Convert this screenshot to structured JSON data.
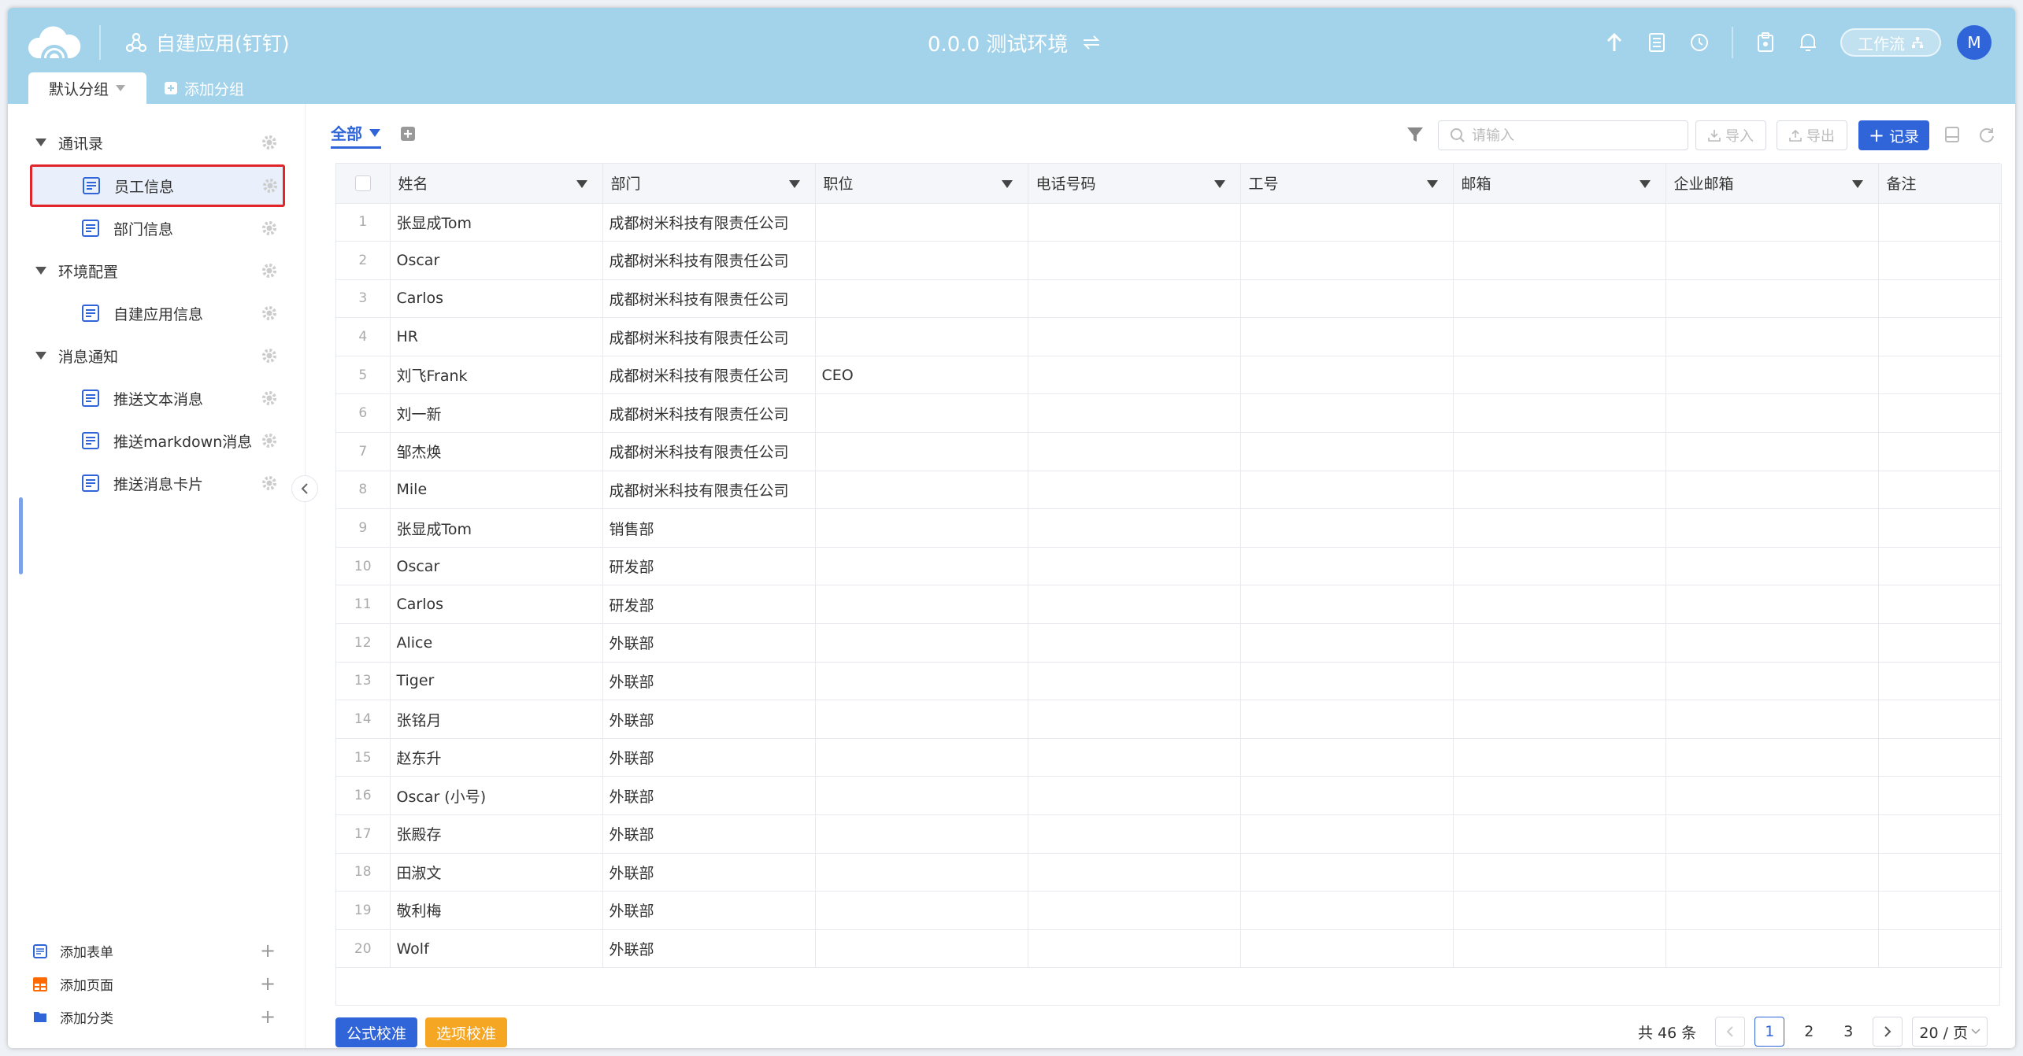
{
  "header": {
    "app_title": "自建应用(钉钉)",
    "env_title": "0.0.0 测试环境",
    "workflow_label": "工作流",
    "avatar_letter": "M"
  },
  "groups": {
    "default_tab": "默认分组",
    "add_group": "添加分组"
  },
  "sidebar": {
    "items": [
      {
        "type": "group",
        "label": "通讯录"
      },
      {
        "type": "child",
        "label": "员工信息",
        "active": true
      },
      {
        "type": "child",
        "label": "部门信息"
      },
      {
        "type": "group",
        "label": "环境配置"
      },
      {
        "type": "child",
        "label": "自建应用信息"
      },
      {
        "type": "group",
        "label": "消息通知"
      },
      {
        "type": "child",
        "label": "推送文本消息"
      },
      {
        "type": "child",
        "label": "推送markdown消息"
      },
      {
        "type": "child",
        "label": "推送消息卡片"
      }
    ],
    "bottom": {
      "add_form": "添加表单",
      "add_page": "添加页面",
      "add_category": "添加分类"
    }
  },
  "toolbar": {
    "view_tab": "全部",
    "search_placeholder": "请输入",
    "import_label": "导入",
    "export_label": "导出",
    "record_label": "记录"
  },
  "table": {
    "columns": [
      "姓名",
      "部门",
      "职位",
      "电话号码",
      "工号",
      "邮箱",
      "企业邮箱",
      "备注"
    ],
    "rows": [
      {
        "n": "1",
        "name": "张显成Tom",
        "dept": "成都树米科技有限责任公司",
        "pos": ""
      },
      {
        "n": "2",
        "name": "Oscar",
        "dept": "成都树米科技有限责任公司",
        "pos": ""
      },
      {
        "n": "3",
        "name": "Carlos",
        "dept": "成都树米科技有限责任公司",
        "pos": ""
      },
      {
        "n": "4",
        "name": "HR",
        "dept": "成都树米科技有限责任公司",
        "pos": ""
      },
      {
        "n": "5",
        "name": "刘飞Frank",
        "dept": "成都树米科技有限责任公司",
        "pos": "CEO"
      },
      {
        "n": "6",
        "name": "刘一新",
        "dept": "成都树米科技有限责任公司",
        "pos": ""
      },
      {
        "n": "7",
        "name": "邹杰焕",
        "dept": "成都树米科技有限责任公司",
        "pos": ""
      },
      {
        "n": "8",
        "name": "Mile",
        "dept": "成都树米科技有限责任公司",
        "pos": ""
      },
      {
        "n": "9",
        "name": "张显成Tom",
        "dept": "销售部",
        "pos": ""
      },
      {
        "n": "10",
        "name": "Oscar",
        "dept": "研发部",
        "pos": ""
      },
      {
        "n": "11",
        "name": "Carlos",
        "dept": "研发部",
        "pos": ""
      },
      {
        "n": "12",
        "name": "Alice",
        "dept": "外联部",
        "pos": ""
      },
      {
        "n": "13",
        "name": "Tiger",
        "dept": "外联部",
        "pos": ""
      },
      {
        "n": "14",
        "name": "张铭月",
        "dept": "外联部",
        "pos": ""
      },
      {
        "n": "15",
        "name": "赵东升",
        "dept": "外联部",
        "pos": ""
      },
      {
        "n": "16",
        "name": "Oscar (小号)",
        "dept": "外联部",
        "pos": ""
      },
      {
        "n": "17",
        "name": "张殿存",
        "dept": "外联部",
        "pos": ""
      },
      {
        "n": "18",
        "name": "田淑文",
        "dept": "外联部",
        "pos": ""
      },
      {
        "n": "19",
        "name": "敬利梅",
        "dept": "外联部",
        "pos": ""
      },
      {
        "n": "20",
        "name": "Wolf",
        "dept": "外联部",
        "pos": ""
      }
    ]
  },
  "footer": {
    "formula_check": "公式校准",
    "option_check": "选项校准",
    "total_text": "共 46 条",
    "pages": [
      "1",
      "2",
      "3"
    ],
    "current_page": "1",
    "page_size": "20 / 页"
  },
  "colors": {
    "header_bg": "#a2d3ea",
    "primary": "#2f65d9",
    "warning": "#f5a623",
    "active_border": "#e0252b"
  }
}
